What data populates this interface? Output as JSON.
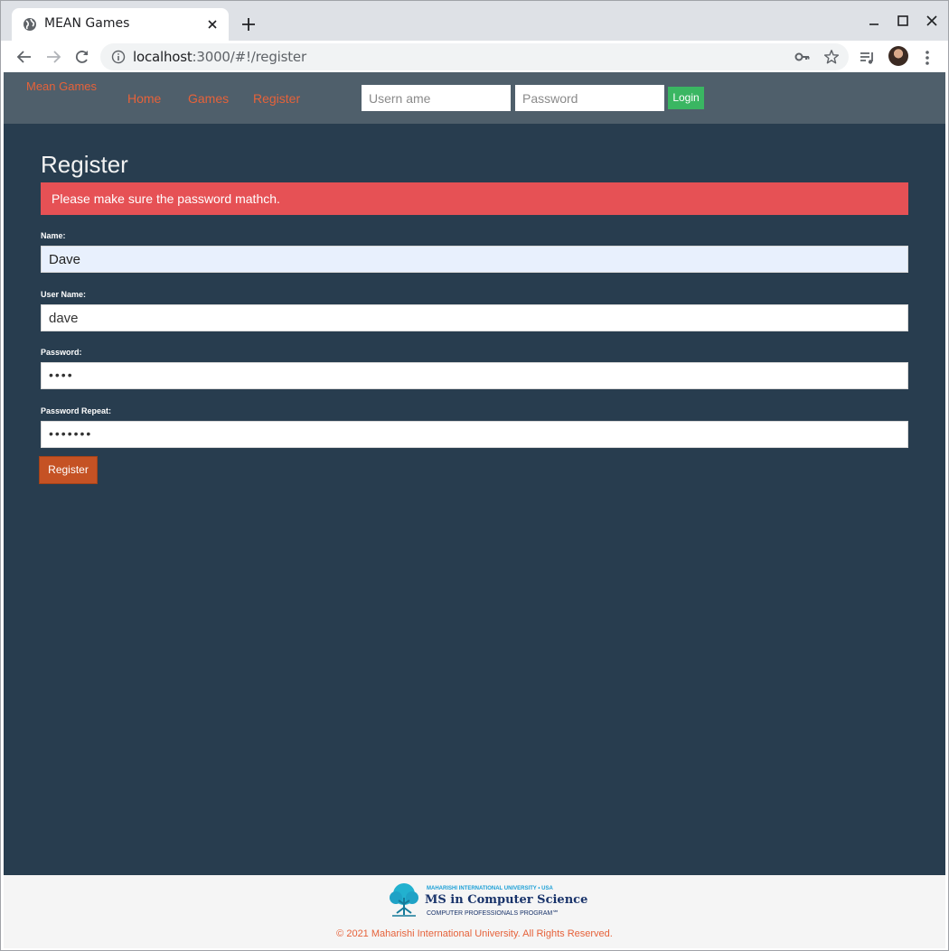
{
  "browser": {
    "tab_title": "MEAN Games",
    "url_host": "localhost",
    "url_rest": ":3000/#!/register"
  },
  "navbar": {
    "brand": "Mean Games",
    "links": [
      "Home",
      "Games",
      "Register"
    ],
    "username_placeholder": "Usern ame",
    "password_placeholder": "Password",
    "login_label": "Login"
  },
  "main": {
    "title": "Register",
    "alert": "Please make sure the password mathch.",
    "name_label": "Name:",
    "name_value": "Dave",
    "username_label": "User Name:",
    "username_value": "dave",
    "password_label": "Password:",
    "password_value": "••••",
    "password_repeat_label": "Password Repeat:",
    "password_repeat_value": "•••••••",
    "register_label": "Register"
  },
  "footer": {
    "logo_line1": "MAHARISHI INTERNATIONAL UNIVERSITY • USA",
    "logo_line2": "MS in Computer Science",
    "logo_line3": "COMPUTER PROFESSIONALS PROGRAM℠",
    "copyright": "© 2021 Maharishi International University. All Rights Reserved."
  },
  "colors": {
    "page_bg": "#283d4f",
    "navbar_bg": "#4f5f6b",
    "link": "#e6623a",
    "alert_bg": "#e65155",
    "login_bg": "#3ab662",
    "register_bg": "#c55224"
  }
}
